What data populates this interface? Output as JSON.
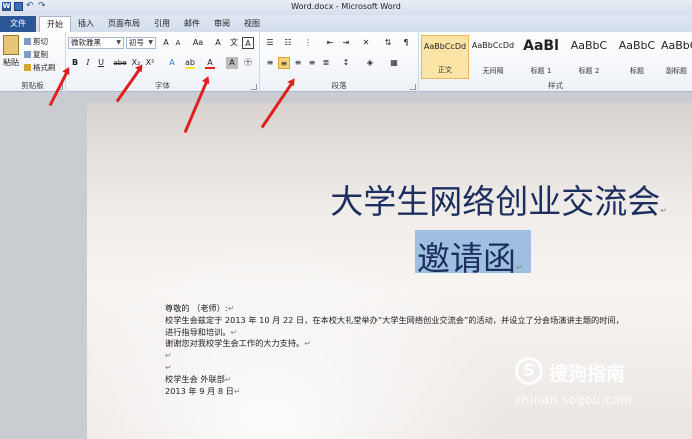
{
  "window": {
    "title": "Word.docx - Microsoft Word"
  },
  "tabs": [
    "文件",
    "开始",
    "插入",
    "页面布局",
    "引用",
    "邮件",
    "审阅",
    "视图"
  ],
  "ribbon": {
    "clipboard": {
      "label": "剪贴板",
      "paste": "粘贴",
      "cut": "剪切",
      "copy": "复制",
      "format_painter": "格式刷"
    },
    "font": {
      "label": "字体",
      "font_name": "微软雅黑",
      "font_size": "初号",
      "bold": "B",
      "italic": "I",
      "underline": "U",
      "strikethrough": "abe",
      "subscript": "X₂",
      "superscript": "X²",
      "grow": "A",
      "shrink": "A",
      "change_case": "Aa",
      "clear": "A",
      "font_color": "A",
      "char_border": "A",
      "char_shade": "A",
      "highlight": "ab"
    },
    "paragraph": {
      "label": "段落"
    },
    "styles": {
      "label": "样式",
      "items": [
        {
          "sample": "AaBbCcDd",
          "name": "正文"
        },
        {
          "sample": "AaBbCcDd",
          "name": "无间隔"
        },
        {
          "sample": "AaBl",
          "name": "标题 1"
        },
        {
          "sample": "AaBbC",
          "name": "标题 2"
        },
        {
          "sample": "AaBbC",
          "name": "标题"
        },
        {
          "sample": "AaBbC",
          "name": "副标题"
        }
      ]
    }
  },
  "document": {
    "title": "大学生网络创业交流会",
    "subtitle": "邀请函",
    "lines": [
      "尊敬的          （老师）:",
      "校学生会兹定于 2013 年 10 月 22 日，在本校大礼堂举办“大学生网络创业交流会”的活动，并设立了分会场演讲主题的时间，",
      "进行指导和培训。",
      "谢谢您对我校学生会工作的大力支持。",
      "",
      "",
      "校学生会 外联部",
      "2013 年 9 月 8 日"
    ]
  },
  "watermark": {
    "logo": "S",
    "brand": "搜狗指南",
    "url": "zhinan.sogou.com"
  },
  "colors": {
    "accent": "#2b5797",
    "arrow": "#e02020",
    "selection": "#9fbfe0",
    "title_text": "#1d2f5e"
  }
}
